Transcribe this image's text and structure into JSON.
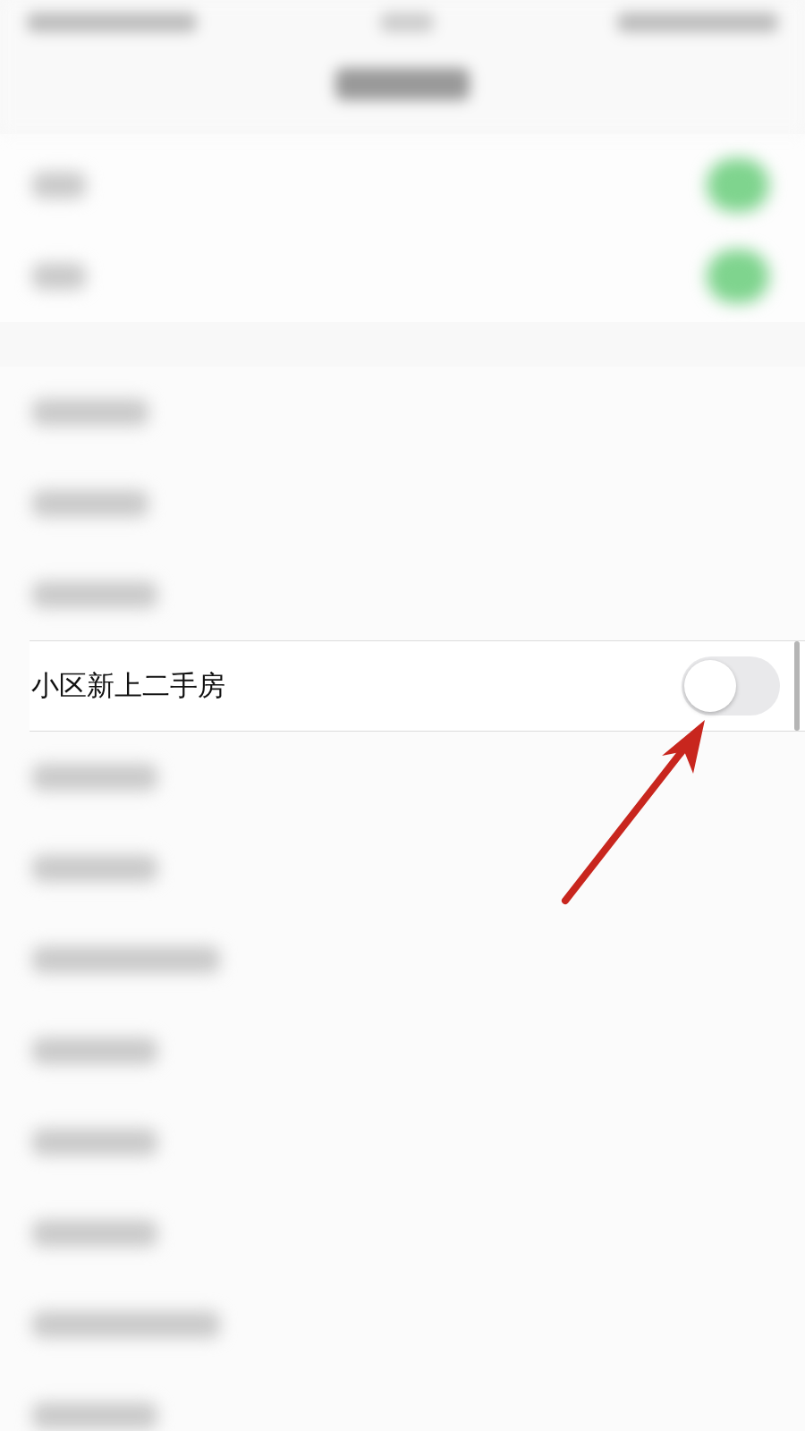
{
  "sections": [
    {
      "rows": [
        {
          "kind": "blurred-toggle",
          "on": true
        },
        {
          "kind": "blurred-toggle",
          "on": true
        }
      ]
    },
    {
      "rows": [
        {
          "kind": "blurred"
        },
        {
          "kind": "blurred"
        },
        {
          "kind": "blurred"
        },
        {
          "kind": "toggle",
          "label": "小区新上二手房",
          "on": false
        },
        {
          "kind": "blurred"
        },
        {
          "kind": "blurred"
        },
        {
          "kind": "blurred"
        },
        {
          "kind": "blurred"
        },
        {
          "kind": "blurred"
        },
        {
          "kind": "blurred"
        },
        {
          "kind": "blurred"
        },
        {
          "kind": "blurred"
        }
      ]
    }
  ]
}
